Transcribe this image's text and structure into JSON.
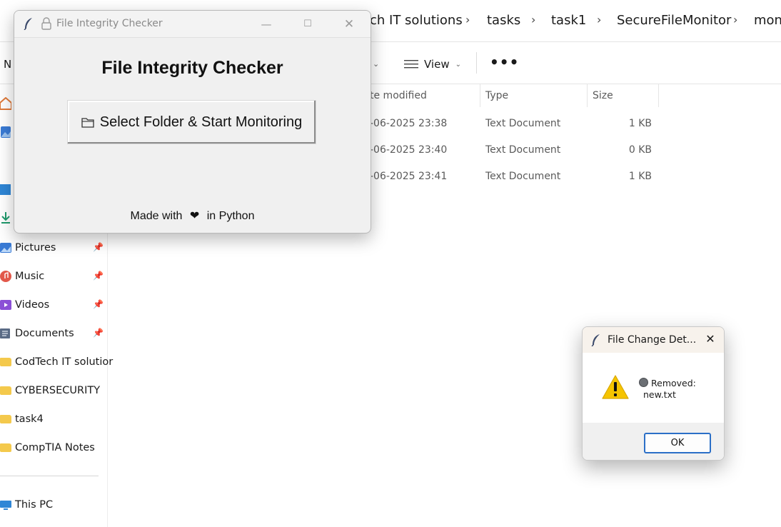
{
  "explorer": {
    "breadcrumbs": [
      "ch IT solutions",
      "tasks",
      "task1",
      "SecureFileMonitor",
      "moni"
    ],
    "toolbar": {
      "new_label": "N",
      "view_label": "View",
      "more_label": "•••"
    },
    "columns": {
      "date_modified": "te modified",
      "type": "Type",
      "size": "Size"
    },
    "files": [
      {
        "date": "-06-2025 23:38",
        "type": "Text Document",
        "size": "1 KB"
      },
      {
        "date": "-06-2025 23:40",
        "type": "Text Document",
        "size": "0 KB"
      },
      {
        "date": "-06-2025 23:41",
        "type": "Text Document",
        "size": "1 KB"
      }
    ],
    "sidebar": [
      {
        "label": "Pictures",
        "pinned": true
      },
      {
        "label": "Music",
        "pinned": true
      },
      {
        "label": "Videos",
        "pinned": true
      },
      {
        "label": "Documents",
        "pinned": true
      },
      {
        "label": "CodTech IT solutior"
      },
      {
        "label": "CYBERSECURITY"
      },
      {
        "label": "task4"
      },
      {
        "label": "CompTIA Notes"
      },
      {
        "label": "This PC"
      }
    ],
    "pin_glyph": "📌"
  },
  "checker": {
    "window_title": "File Integrity Checker",
    "heading": "File Integrity Checker",
    "button_label": "Select Folder & Start Monitoring",
    "footer_prefix": "Made with",
    "footer_heart": "❤",
    "footer_suffix": "in Python"
  },
  "dialog": {
    "title": "File Change Det...",
    "message_line1": "Removed:",
    "message_line2": "new.txt",
    "ok_label": "OK"
  },
  "colors": {
    "accent": "#2b6fc7",
    "folder": "#f4c94c",
    "warning": "#f5c400"
  }
}
